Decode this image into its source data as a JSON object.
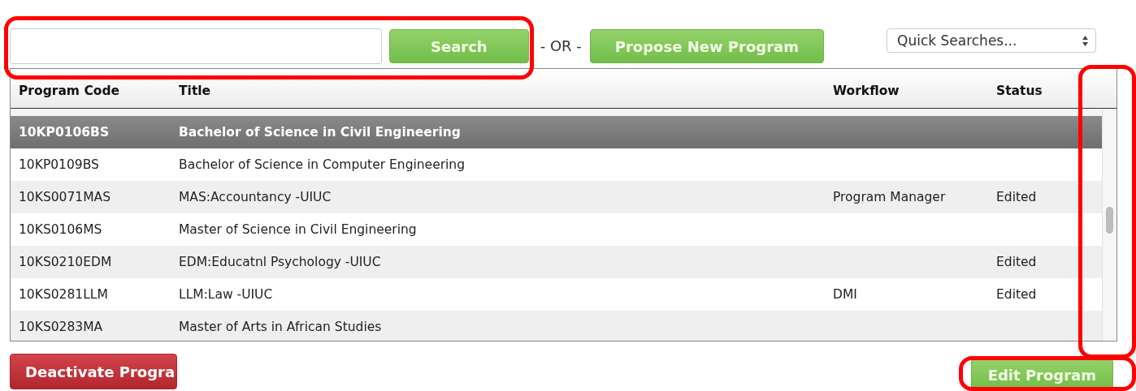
{
  "search": {
    "button": "Search"
  },
  "separator": "- OR -",
  "propose_button": "Propose New Program",
  "quick_searches": {
    "value": "Quick Searches..."
  },
  "table": {
    "columns": [
      "Program Code",
      "Title",
      "Workflow",
      "Status"
    ],
    "rows": [
      {
        "code": "10KP0106BS",
        "title": "Bachelor of Science in Civil Engineering",
        "workflow": "",
        "status": "",
        "selected": true
      },
      {
        "code": "10KP0109BS",
        "title": "Bachelor of Science in Computer Engineering",
        "workflow": "",
        "status": "",
        "selected": false
      },
      {
        "code": "10KS0071MAS",
        "title": "MAS:Accountancy -UIUC",
        "workflow": "Program Manager",
        "status": "Edited",
        "selected": false
      },
      {
        "code": "10KS0106MS",
        "title": "Master of Science in Civil Engineering",
        "workflow": "",
        "status": "",
        "selected": false
      },
      {
        "code": "10KS0210EDM",
        "title": "EDM:Educatnl Psychology -UIUC",
        "workflow": "",
        "status": "Edited",
        "selected": false
      },
      {
        "code": "10KS0281LLM",
        "title": "LLM:Law -UIUC",
        "workflow": "DMI",
        "status": "Edited",
        "selected": false
      },
      {
        "code": "10KS0283MA",
        "title": "Master of Arts in African Studies",
        "workflow": "",
        "status": "",
        "selected": false
      }
    ]
  },
  "deactivate_button": "Deactivate Progra",
  "edit_button": "Edit Program",
  "annotations": [
    {
      "kind": "highlight"
    },
    {
      "kind": "highlight"
    },
    {
      "kind": "highlight"
    }
  ]
}
